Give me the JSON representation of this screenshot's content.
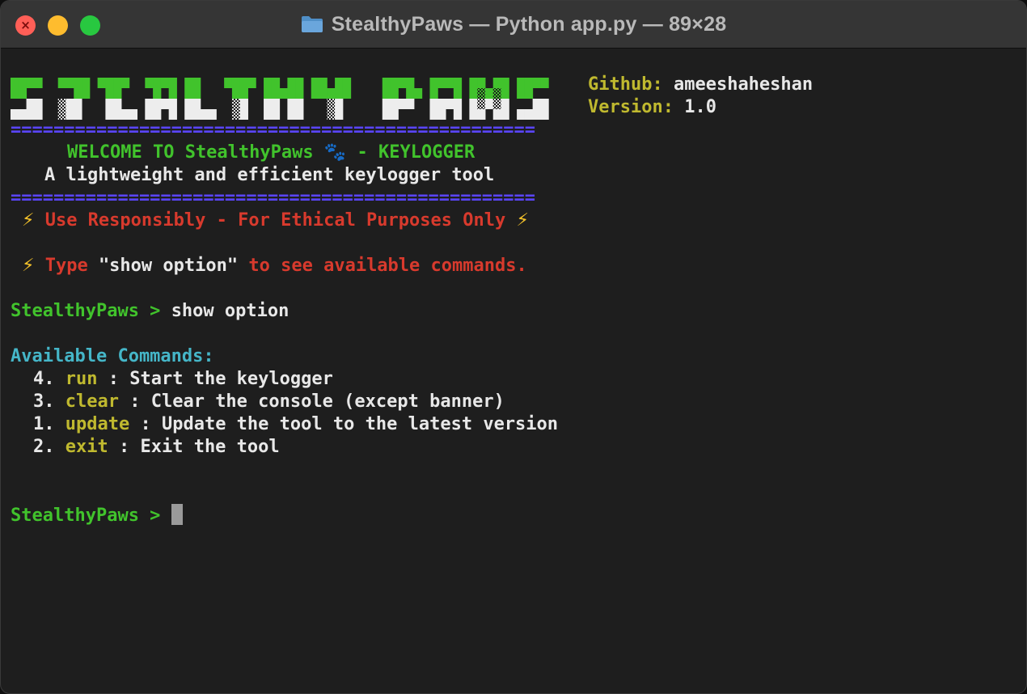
{
  "window": {
    "title": "StealthyPaws — Python app.py — 89×28",
    "colors": {
      "close": "#ff5f57",
      "minimize": "#febc2e",
      "zoom": "#28c840",
      "background": "#1e1e1e"
    }
  },
  "banner": {
    "logo_text": "STEALTHY PAWS",
    "github_label": "Github:",
    "github_value": "ameeshaheshan",
    "version_label": "Version:",
    "version_value": "1.0",
    "divider": "=================================================",
    "welcome_prefix": "WELCOME TO StealthyPaws",
    "welcome_suffix": " - KEYLOGGER",
    "tagline": "A lightweight and efficient keylogger tool",
    "warning": "Use Responsibly - For Ethical Purposes Only",
    "hint_before": "Type ",
    "hint_command": "\"show option\"",
    "hint_after": " to see available commands."
  },
  "session": {
    "prompt": "StealthyPaws > ",
    "entered_command": "show option",
    "available_header": "Available Commands:",
    "commands": [
      {
        "num": "4.",
        "name": "run",
        "desc": " : Start the keylogger"
      },
      {
        "num": "3.",
        "name": "clear",
        "desc": " : Clear the console (except banner)"
      },
      {
        "num": "1.",
        "name": "update",
        "desc": " : Update the tool to the latest version"
      },
      {
        "num": "2.",
        "name": "exit",
        "desc": " : Exit the tool"
      }
    ],
    "current_prompt": "StealthyPaws > "
  }
}
